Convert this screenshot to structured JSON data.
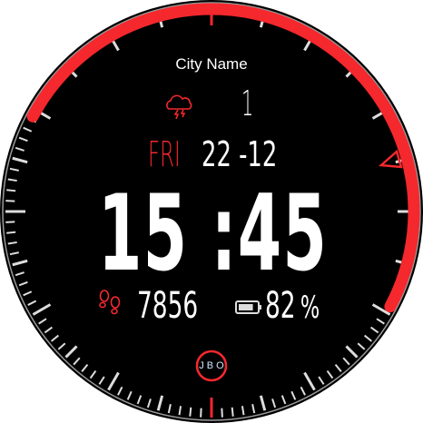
{
  "city": "City Name",
  "weather": {
    "icon": "thunderstorm-cloud-icon",
    "value": "1"
  },
  "date": {
    "weekday": "FRI",
    "day_month": "22 -12"
  },
  "time": {
    "display": "15 :45"
  },
  "steps": {
    "icon": "footsteps-icon",
    "value": "7856"
  },
  "battery": {
    "icon": "battery-icon",
    "value": "82",
    "unit": "%",
    "level_percent": 82
  },
  "logo": "JBO",
  "colors": {
    "accent": "#f5282d",
    "background": "#000000",
    "text": "#ffffff",
    "logo_text": "#cfe8ff"
  }
}
